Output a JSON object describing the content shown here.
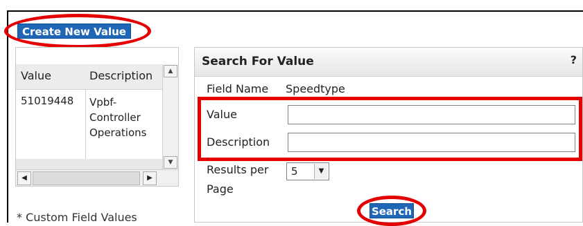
{
  "toolbar": {
    "create_label": "Create New Value"
  },
  "value_list": {
    "columns": [
      "Value",
      "Description"
    ],
    "rows": [
      {
        "value": "51019448",
        "description": "Vpbf-\nController\nOperations"
      }
    ]
  },
  "footer": {
    "custom_note": "* Custom Field Values"
  },
  "search": {
    "title": "Search For Value",
    "help": "?",
    "field_name_label": "Field Name",
    "field_name_value": "Speedtype",
    "value_label": "Value",
    "value_input": "",
    "description_label": "Description",
    "description_input": "",
    "results_label_line1": "Results per",
    "results_label_line2": "Page",
    "results_value": "5",
    "search_label": "Search"
  },
  "colors": {
    "accent": "#1f66b6",
    "highlight": "#e40000"
  },
  "icons": {
    "scroll_up": "triangle-up-icon",
    "scroll_down": "triangle-down-icon",
    "scroll_left": "triangle-left-icon",
    "scroll_right": "triangle-right-icon",
    "dropdown": "chevron-down-icon"
  }
}
